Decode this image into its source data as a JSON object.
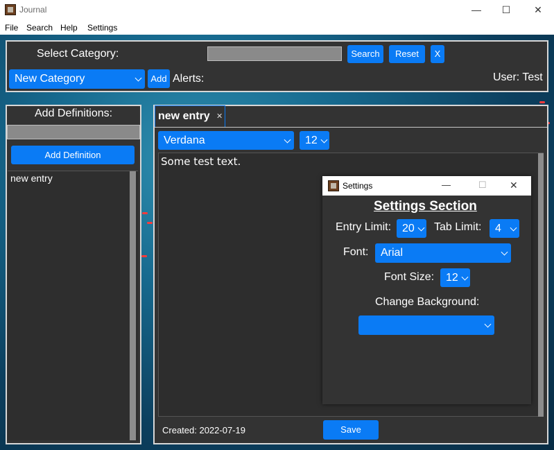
{
  "window": {
    "title": "Journal",
    "controls": {
      "minimize": "—",
      "maximize": "☐",
      "close": "✕"
    }
  },
  "menu": [
    "File",
    "Search",
    "Help",
    "Settings"
  ],
  "top_panel": {
    "select_category_label": "Select Category:",
    "search_value": "",
    "search_button": "Search",
    "reset_button": "Reset",
    "clear_button": "X",
    "category_select": "New Category",
    "add_button": "Add",
    "alerts_label": "Alerts:",
    "user_label": "User: Test"
  },
  "left_panel": {
    "title": "Add Definitions:",
    "definition_input": "",
    "add_definition_button": "Add Definition",
    "items": [
      "new entry"
    ]
  },
  "editor": {
    "tab_label": "new entry",
    "tab_close": "✕",
    "font_select": "Verdana",
    "size_select": "12",
    "body_text": "Some test text.",
    "created_label": "Created: 2022-07-19",
    "save_button": "Save"
  },
  "settings_dialog": {
    "title": "Settings",
    "controls": {
      "minimize": "—",
      "maximize": "☐",
      "close": "✕"
    },
    "heading": "Settings Section",
    "entry_limit_label": "Entry Limit:",
    "entry_limit_value": "20",
    "tab_limit_label": "Tab Limit:",
    "tab_limit_value": "4",
    "font_label": "Font:",
    "font_value": "Arial",
    "font_size_label": "Font Size:",
    "font_size_value": "12",
    "change_background_label": "Change Background:",
    "background_value": ""
  },
  "colors": {
    "accent": "#0a7bf5",
    "panel": "#333333"
  }
}
